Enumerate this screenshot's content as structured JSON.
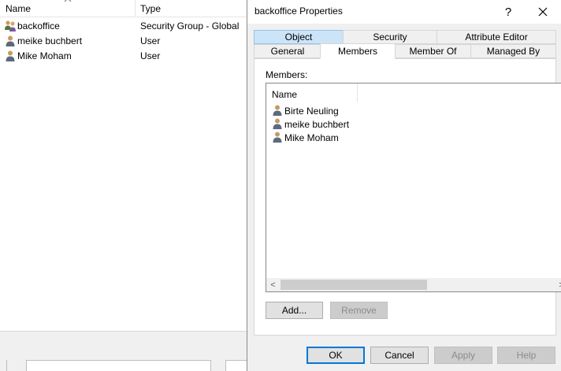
{
  "background_list": {
    "columns": {
      "name": "Name",
      "type": "Type"
    },
    "rows": [
      {
        "name": "backoffice",
        "type": "Security Group - Global",
        "icon": "group-icon"
      },
      {
        "name": "meike buchbert",
        "type": "User",
        "icon": "user-icon"
      },
      {
        "name": "Mike Moham",
        "type": "User",
        "icon": "user-icon"
      }
    ]
  },
  "dialog": {
    "title": "backoffice Properties",
    "help_label": "?",
    "close_label": "✕",
    "tabs_row1": [
      "Object",
      "Security",
      "Attribute Editor"
    ],
    "tabs_row2": [
      "General",
      "Members",
      "Member Of",
      "Managed By"
    ],
    "selected_tab": "Members",
    "members_label": "Members:",
    "list_header": "Name",
    "members": [
      {
        "name": "Birte Neuling",
        "icon": "user-icon"
      },
      {
        "name": "meike buchbert",
        "icon": "user-icon"
      },
      {
        "name": "Mike Moham",
        "icon": "user-icon"
      }
    ],
    "scroll_left": "<",
    "scroll_right": ">",
    "add_label": "Add...",
    "remove_label": "Remove",
    "ok_label": "OK",
    "cancel_label": "Cancel",
    "apply_label": "Apply",
    "help_button_label": "Help"
  },
  "colors": {
    "accent": "#0078d7",
    "tab_highlight": "#cce4f7",
    "dialog_bg": "#f0f0f0"
  }
}
